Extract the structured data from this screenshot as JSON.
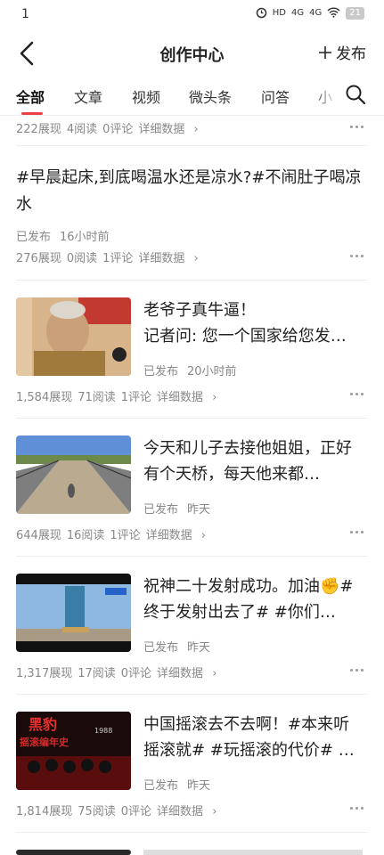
{
  "status_bar": {
    "time": "1",
    "signal_labels": [
      "HD",
      "4G",
      "4G"
    ],
    "battery": "21"
  },
  "nav": {
    "title": "创作中心",
    "publish_label": "发布"
  },
  "tabs": [
    {
      "label": "全部",
      "active": true
    },
    {
      "label": "文章",
      "active": false
    },
    {
      "label": "视频",
      "active": false
    },
    {
      "label": "微头条",
      "active": false
    },
    {
      "label": "问答",
      "active": false
    },
    {
      "label": "小",
      "active": false
    }
  ],
  "detail_label": "详细数据",
  "items": [
    {
      "type": "stats-only",
      "views": "222展现",
      "reads": "4阅读",
      "comments": "0评论"
    },
    {
      "type": "text",
      "title": "#早晨起床,到底喝温水还是凉水?#不闹肚子喝凉水",
      "status": "已发布",
      "time": "16小时前",
      "views": "276展现",
      "reads": "0阅读",
      "comments": "1评论"
    },
    {
      "type": "media",
      "thumb": "old-man-portrait",
      "title": "老爷子真牛逼！\n记者问: 您一个国家给您发…",
      "status": "已发布",
      "time": "20小时前",
      "views": "1,584展现",
      "reads": "71阅读",
      "comments": "1评论"
    },
    {
      "type": "media",
      "thumb": "bridge-walkway",
      "title": "今天和儿子去接他姐姐，正好有个天桥，每天他来都…",
      "status": "已发布",
      "time": "昨天",
      "views": "644展现",
      "reads": "16阅读",
      "comments": "1评论"
    },
    {
      "type": "media",
      "thumb": "rocket-launch-tower",
      "title": "祝神二十发射成功。加油✊#终于发射出去了# #你们…",
      "status": "已发布",
      "time": "昨天",
      "views": "1,317展现",
      "reads": "17阅读",
      "comments": "0评论"
    },
    {
      "type": "media",
      "thumb": "rock-band-poster",
      "thumb_text": [
        "黑豹",
        "摇滚编年史",
        "1988"
      ],
      "title": "中国摇滚去不去啊！#本来听摇滚就# #玩摇滚的代价# …",
      "status": "已发布",
      "time": "昨天",
      "views": "1,814展现",
      "reads": "75阅读",
      "comments": "0评论"
    }
  ]
}
